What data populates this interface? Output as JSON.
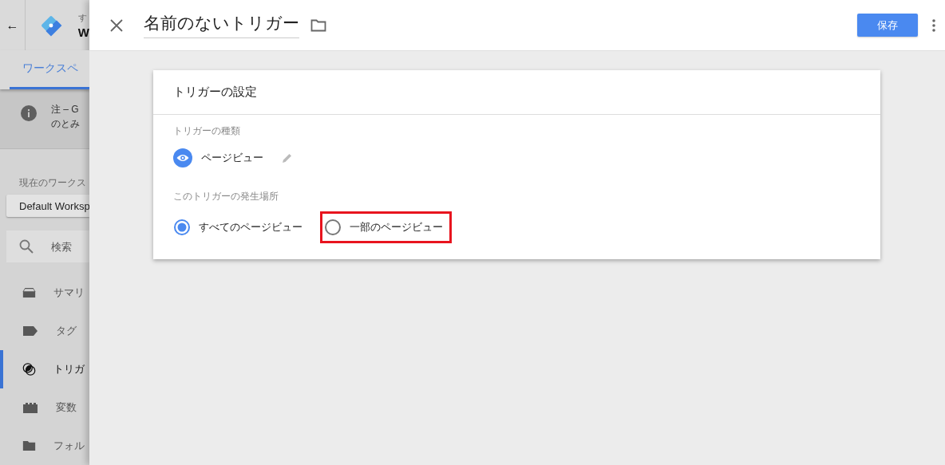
{
  "sidebar": {
    "back": "←",
    "account_label": "す",
    "container_name": "W",
    "tab": {
      "label": "ワークスペ",
      "selected": true
    },
    "notice": {
      "lines": [
        "注 – G",
        "のとみ"
      ]
    },
    "workspace_label": "現在のワークス",
    "workspace": "Default Worksp",
    "search": {
      "placeholder": "検索"
    },
    "items": [
      {
        "kind": "summary",
        "label": "サマリ",
        "selected": false
      },
      {
        "kind": "tag",
        "label": "タグ",
        "selected": false
      },
      {
        "kind": "trigger",
        "label": "トリガ",
        "selected": true
      },
      {
        "kind": "variable",
        "label": "変数",
        "selected": false
      },
      {
        "kind": "folder",
        "label": "フォル",
        "selected": false
      }
    ]
  },
  "editor": {
    "title": "名前のないトリガー",
    "save": "保存",
    "card": {
      "heading": "トリガーの設定",
      "type_label": "トリガーの種類",
      "type": "ページビュー",
      "where_label": "このトリガーの発生場所",
      "options": [
        {
          "label": "すべてのページビュー",
          "selected": true,
          "highlighted": false
        },
        {
          "label": "一部のページビュー",
          "selected": false,
          "highlighted": true
        }
      ]
    }
  }
}
